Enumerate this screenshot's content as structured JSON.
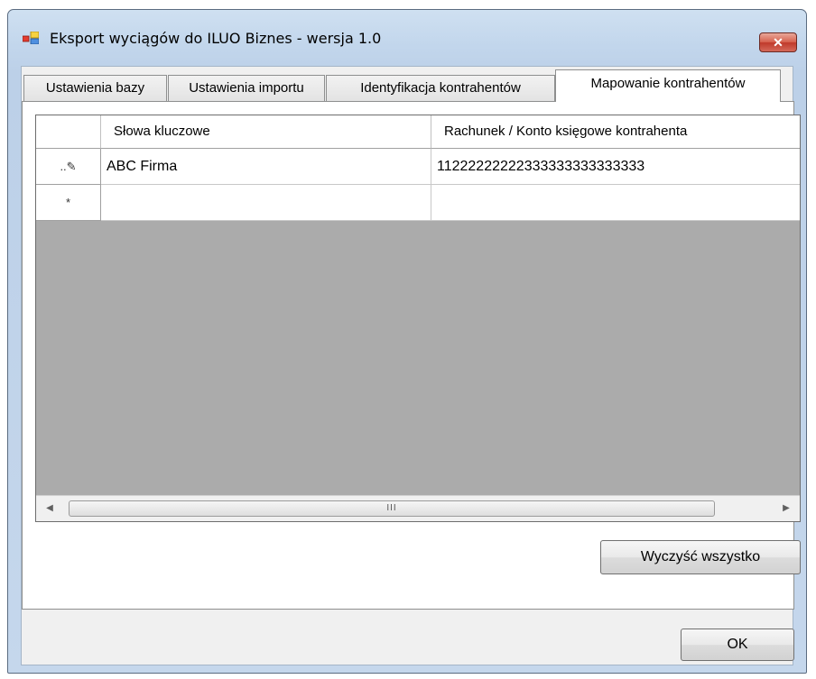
{
  "window": {
    "title": "Eksport wyciągów do ILUO Biznes - wersja 1.0",
    "close_label": "✕"
  },
  "tabs": [
    {
      "label": "Ustawienia bazy",
      "active": false
    },
    {
      "label": "Ustawienia importu",
      "active": false
    },
    {
      "label": "Identyfikacja kontrahentów",
      "active": false
    },
    {
      "label": "Mapowanie kontrahentów",
      "active": true
    }
  ],
  "grid": {
    "columns": [
      "Słowa kluczowe",
      "Rachunek / Konto księgowe kontrahenta"
    ],
    "rows": [
      {
        "indicator": "..✎",
        "keywords": "ABC Firma",
        "account": "11222222222333333333333333"
      },
      {
        "indicator": "*",
        "keywords": "",
        "account": ""
      }
    ],
    "scroll": {
      "left": "◀",
      "right": "▶",
      "grip": "III"
    }
  },
  "buttons": {
    "clear_all": "Wyczyść wszystko",
    "ok": "OK"
  },
  "colors": {
    "grid_background": "#ababab",
    "close_button": "#c0392b"
  }
}
